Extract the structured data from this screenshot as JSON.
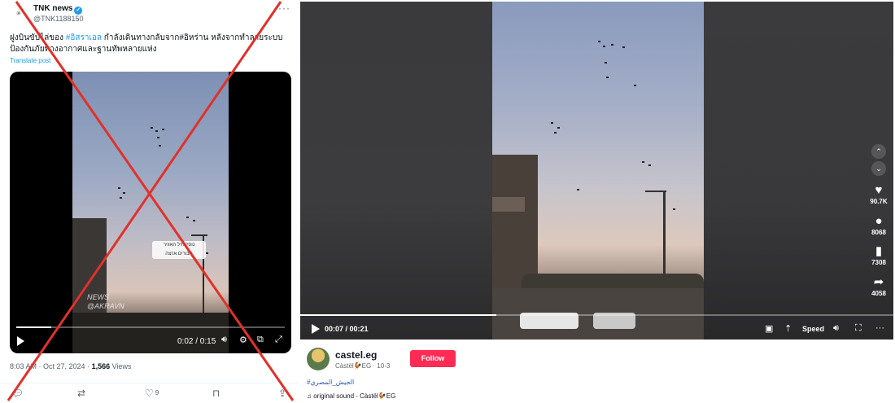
{
  "x_post": {
    "account_name": "TNK news",
    "account_handle": "@TNK1188150",
    "text_line1": "ฝูงบินขับไล่ของ ",
    "hashtag_israel": "#อิสราเอล",
    "text_line1b": " กำลังเดินทางกลับจาก",
    "hashtag_iran": "#อิหร่าน",
    "text_line1c": " หลังจากทำลายระบบ",
    "text_line2": "ป้องกันภัยทางอากาศและฐานทัพหลายแห่ง",
    "translate": "Translate post",
    "video": {
      "sticker_line1": "נוסיי חיל האוויר",
      "sticker_line2": "גיבורים ארצה",
      "watermark_line1": "NEWS",
      "watermark_line2": "@AKRAVN",
      "time": "0:02 / 0:15",
      "progress": 0.13
    },
    "meta_time": "8:03 AM · Oct 27, 2024 · ",
    "views": "1,566",
    "views_label": " Views",
    "likes": "9"
  },
  "tiktok": {
    "time": "00:07 / 00:21",
    "progress": 0.33,
    "speed_label": "Speed",
    "likes": "90.7K",
    "comments": "8068",
    "saves": "7308",
    "shares": "4058",
    "author_name": "castel.eg",
    "author_sub": "Càstël🐓EG · 10-3",
    "follow_label": "Follow",
    "hashtag": "#الجيش_المصري",
    "sound": "♫ original sound - Càstël🐓EG"
  },
  "colors": {
    "cross": "#e0312b",
    "follow": "#fe2c55",
    "link": "#1d9bf0"
  }
}
